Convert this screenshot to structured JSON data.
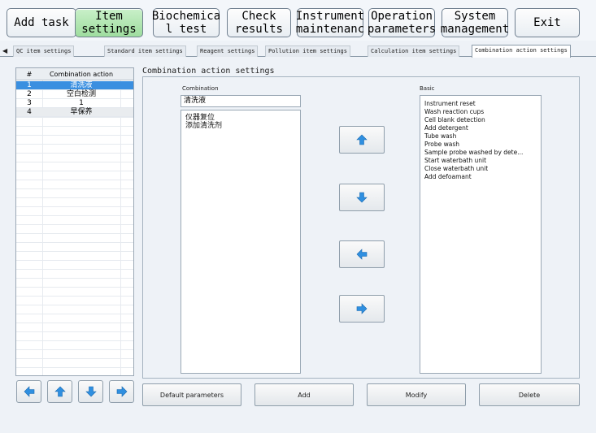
{
  "toolbar": {
    "buttons": [
      {
        "label": "Add task"
      },
      {
        "label": "Item\nsettings"
      },
      {
        "label": "Biochemica\nl test"
      },
      {
        "label": "Check\nresults"
      },
      {
        "label": "Instrument\nmaintenanc"
      },
      {
        "label": "Operation\nparameters"
      },
      {
        "label": "System\nmanagement"
      },
      {
        "label": "Exit"
      }
    ]
  },
  "tabs": [
    {
      "label": "QC item settings"
    },
    {
      "label": "Standard item settings"
    },
    {
      "label": "Reagent settings"
    },
    {
      "label": "Pollution item settings"
    },
    {
      "label": "Calculation item settings"
    },
    {
      "label": "Combination action settings"
    }
  ],
  "left_table": {
    "headers": [
      "#",
      "Combination action"
    ],
    "rows": [
      {
        "num": "1",
        "name": "清洗液"
      },
      {
        "num": "2",
        "name": "空白检测"
      },
      {
        "num": "3",
        "name": "1"
      },
      {
        "num": "4",
        "name": "早保养"
      }
    ]
  },
  "panel": {
    "title": "Combination action settings",
    "combination_label": "Combination",
    "basic_label": "Basic",
    "combination_name": "清洗液",
    "combination_items": [
      "仪器复位",
      "添加清洗剂"
    ],
    "basic_items": [
      "Instrument reset",
      "Wash reaction cups",
      "Cell blank detection",
      "Add detergent",
      "Tube wash",
      "Probe wash",
      "Sample probe washed by dete...",
      "Start waterbath unit",
      "Close waterbath unit",
      "Add defoamant"
    ]
  },
  "actions": {
    "default_parameters": "Default parameters",
    "add": "Add",
    "modify": "Modify",
    "delete": "Delete"
  },
  "colors": {
    "active_button": "#9edd9e",
    "selected_row": "#3a8fe0",
    "arrow_blue": "#2f8fe0"
  },
  "icons": {
    "up": "up-arrow-icon",
    "down": "down-arrow-icon",
    "left": "left-arrow-icon",
    "right": "right-arrow-icon"
  }
}
